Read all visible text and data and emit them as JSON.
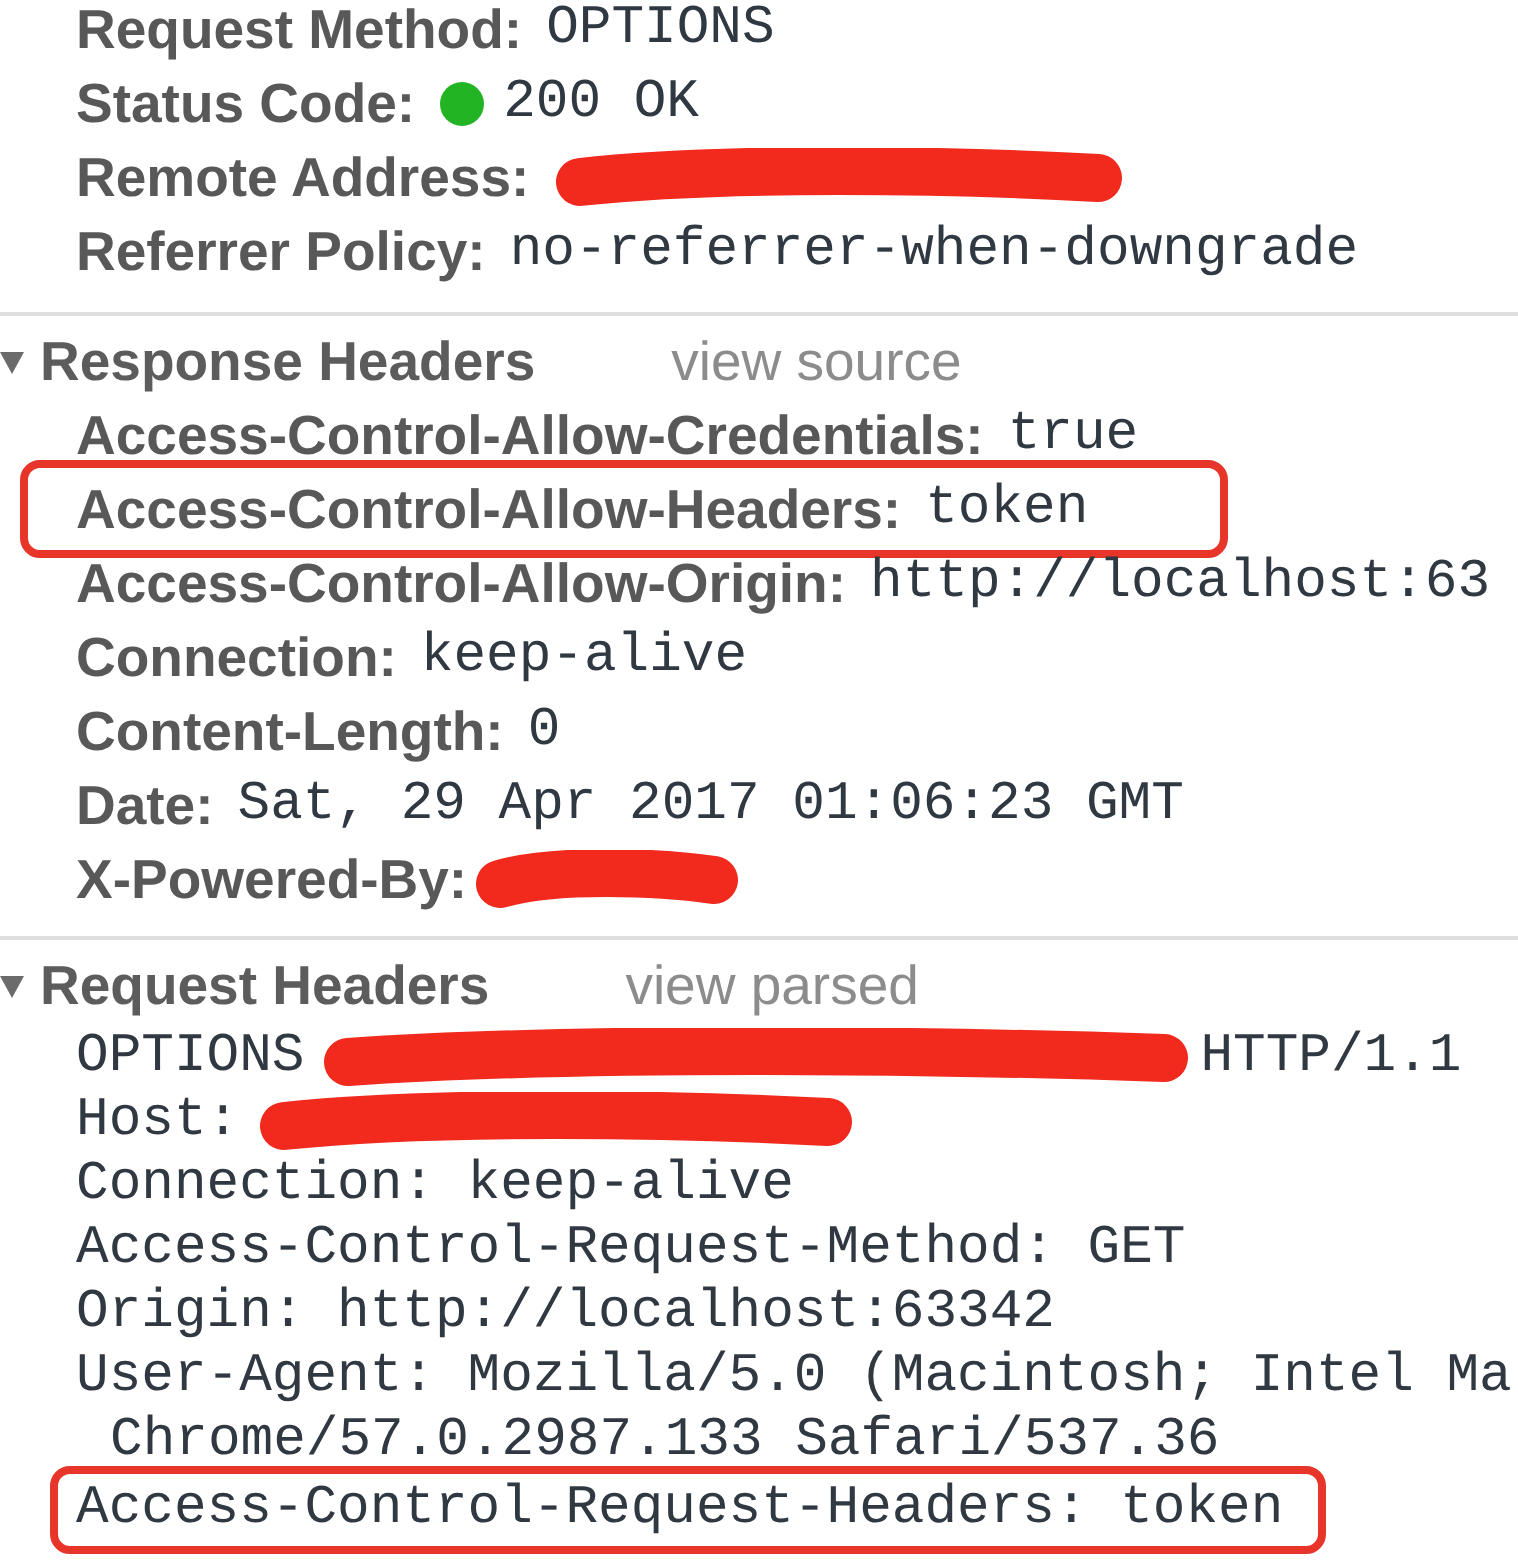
{
  "general": {
    "rows": [
      {
        "name": "Request Method:",
        "value": "OPTIONS",
        "redacted": false,
        "highlighted": false
      },
      {
        "name": "Status Code:",
        "value": "200 OK",
        "color": "#22b422",
        "redacted": false,
        "highlighted": false
      },
      {
        "name": "Remote Address:",
        "redacted": true,
        "highlighted": false
      },
      {
        "name": "Referrer Policy:",
        "value": "no-referrer-when-downgrade",
        "redacted": false,
        "highlighted": false
      }
    ]
  },
  "response_headers": {
    "title": "Response Headers",
    "expanded": true,
    "link": "view source",
    "rows": [
      {
        "name": "Access-Control-Allow-Credentials:",
        "value": "true",
        "redacted": false,
        "highlighted": false
      },
      {
        "name": "Access-Control-Allow-Headers:",
        "value": "token",
        "redacted": false,
        "highlighted": true
      },
      {
        "name": "Access-Control-Allow-Origin:",
        "value": "http://localhost:63",
        "redacted": false,
        "highlighted": false
      },
      {
        "name": "Connection:",
        "value": "keep-alive",
        "redacted": false,
        "highlighted": false
      },
      {
        "name": "Content-Length:",
        "value": "0",
        "redacted": false,
        "highlighted": false
      },
      {
        "name": "Date:",
        "value": "Sat, 29 Apr 2017 01:06:23 GMT",
        "redacted": false,
        "highlighted": false
      },
      {
        "name": "X-Powered-By:",
        "redacted": true,
        "highlighted": false
      }
    ]
  },
  "request_headers": {
    "title": "Request Headers",
    "expanded": true,
    "link": "view parsed",
    "lines": [
      {
        "kind": "line",
        "highlighted": false,
        "parts": [
          {
            "kind": "text",
            "text": "OPTIONS"
          },
          {
            "kind": "redaction"
          },
          {
            "kind": "text",
            "text": "HTTP/1.1"
          }
        ]
      },
      {
        "kind": "line",
        "highlighted": false,
        "parts": [
          {
            "kind": "text",
            "text": "Host:"
          },
          {
            "kind": "redaction"
          }
        ]
      },
      {
        "kind": "line",
        "highlighted": false,
        "parts": [
          {
            "kind": "text",
            "text": "Connection: keep-alive"
          }
        ]
      },
      {
        "kind": "line",
        "highlighted": false,
        "parts": [
          {
            "kind": "text",
            "text": "Access-Control-Request-Method: GET"
          }
        ]
      },
      {
        "kind": "line",
        "highlighted": false,
        "parts": [
          {
            "kind": "text",
            "text": "Origin: http://localhost:63342"
          }
        ]
      },
      {
        "kind": "line",
        "highlighted": false,
        "parts": [
          {
            "kind": "text",
            "text": "User-Agent: Mozilla/5.0 (Macintosh; Intel Ma"
          }
        ]
      },
      {
        "kind": "continuation",
        "highlighted": false,
        "parts": [
          {
            "kind": "text",
            "text": "Chrome/57.0.2987.133 Safari/537.36"
          }
        ]
      },
      {
        "kind": "line",
        "highlighted": true,
        "parts": [
          {
            "kind": "text",
            "text": "Access-Control-Request-Headers: token"
          }
        ]
      }
    ]
  }
}
